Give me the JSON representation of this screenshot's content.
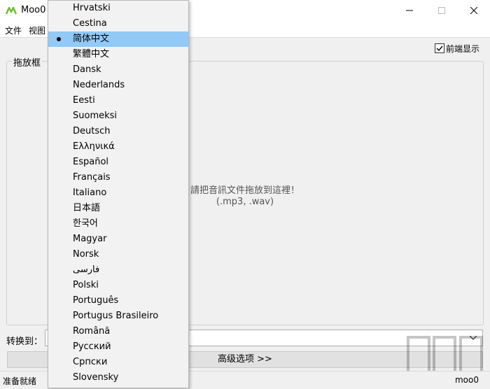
{
  "window": {
    "title": "Moo0"
  },
  "menu": {
    "file": "文件",
    "view": "视图"
  },
  "options": {
    "front_display_label": "前端显示",
    "front_display_checked": true
  },
  "dropzone": {
    "group_label": "拖放框",
    "hint_line1": "請把音訊文件拖放到這裡！",
    "hint_line2": "(.mp3, .wav)"
  },
  "convert": {
    "label": "转换到：",
    "selected_value": ""
  },
  "advanced_button": "高级选项 >>",
  "status": {
    "text": "准备就绪",
    "right": "moo0"
  },
  "language_menu": {
    "selected_index": 2,
    "items": [
      "Hrvatski",
      "Cestina",
      "简体中文",
      "繁體中文",
      "Dansk",
      "Nederlands",
      "Eesti",
      "Suomeksi",
      "Deutsch",
      "Ελληνικά",
      "Español",
      "Français",
      "Italiano",
      "日本語",
      "한국어",
      "Magyar",
      "Norsk",
      "فارسی",
      "Polski",
      "Português",
      "Portugus Brasileiro",
      "Română",
      "Русский",
      "Српски",
      "Slovensky"
    ]
  },
  "colors": {
    "accent_icon": "#6bbf2a",
    "selection": "#91c9f7"
  }
}
